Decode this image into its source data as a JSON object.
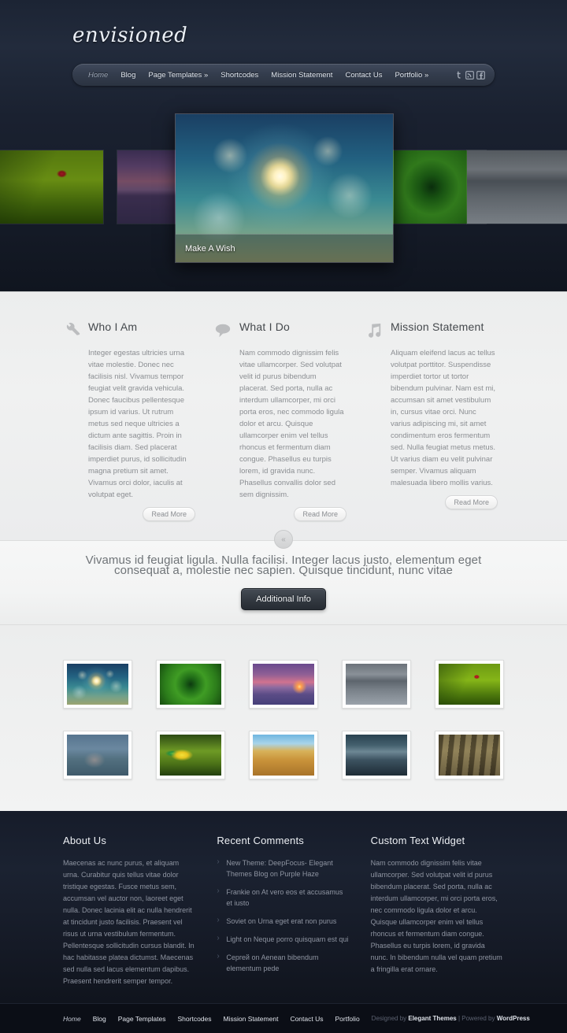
{
  "site": {
    "logo": "envisioned"
  },
  "nav": {
    "items": [
      {
        "label": "Home",
        "active": true
      },
      {
        "label": "Blog",
        "active": false
      },
      {
        "label": "Page Templates »",
        "active": false
      },
      {
        "label": "Shortcodes",
        "active": false
      },
      {
        "label": "Mission Statement",
        "active": false
      },
      {
        "label": "Contact Us",
        "active": false
      },
      {
        "label": "Portfolio »",
        "active": false
      }
    ],
    "social": [
      "twitter-icon",
      "rss-icon",
      "facebook-icon"
    ]
  },
  "slider": {
    "featured_caption": "Make A Wish",
    "thumbs": [
      "grass-ladybug",
      "bridge-sunset",
      "green-leaf",
      "pier-pavilion"
    ]
  },
  "features": {
    "columns": [
      {
        "icon": "wrench-icon",
        "title": "Who I Am",
        "body": "Integer egestas ultricies urna vitae molestie. Donec nec facilisis nisl. Vivamus tempor feugiat velit gravida vehicula. Donec faucibus pellentesque ipsum id varius. Ut rutrum metus sed neque ultricies a dictum ante sagittis. Proin in facilisis diam. Sed placerat imperdiet purus, id sollicitudin magna pretium sit amet. Vivamus orci dolor, iaculis at volutpat eget.",
        "button": "Read More"
      },
      {
        "icon": "speech-bubble-icon",
        "title": "What I Do",
        "body": "Nam commodo dignissim felis vitae ullamcorper. Sed volutpat velit id purus bibendum placerat. Sed porta, nulla ac interdum ullamcorper, mi orci porta eros, nec commodo ligula dolor et arcu. Quisque ullamcorper enim vel tellus rhoncus et fermentum diam congue. Phasellus eu turpis lorem, id gravida nunc. Phasellus convallis dolor sed sem dignissim.",
        "button": "Read More"
      },
      {
        "icon": "music-note-icon",
        "title": "Mission Statement",
        "body": "Aliquam eleifend lacus ac tellus volutpat porttitor. Suspendisse imperdiet tortor ut tortor bibendum pulvinar. Nam est mi, accumsan sit amet vestibulum in, cursus vitae orci. Nunc varius adipiscing mi, sit amet condimentum eros fermentum sed. Nulla feugiat metus metus. Ut varius diam eu velit pulvinar semper. Vivamus aliquam malesuada libero mollis varius.",
        "button": "Read More"
      }
    ]
  },
  "tagline": {
    "badge": "«",
    "text": "Vivamus id feugiat ligula. Nulla facilisi. Integer lacus justo, elementum eget consequat a, molestie nec sapien. Quisque tincidunt, nunc vitae",
    "button": "Additional Info"
  },
  "gallery": {
    "items": [
      {
        "name": "dandelion"
      },
      {
        "name": "green-leaf"
      },
      {
        "name": "bridge-sunset"
      },
      {
        "name": "pier-pavilion"
      },
      {
        "name": "grass-ladybug"
      },
      {
        "name": "snow-monkeys"
      },
      {
        "name": "toucan"
      },
      {
        "name": "wheat-field"
      },
      {
        "name": "seascape"
      },
      {
        "name": "bamboo"
      }
    ]
  },
  "footer": {
    "widgets": [
      {
        "title": "About Us",
        "type": "text",
        "body": "Maecenas ac nunc purus, et aliquam urna. Curabitur quis tellus vitae dolor tristique egestas. Fusce metus sem, accumsan vel auctor non, laoreet eget nulla. Donec lacinia elit ac nulla hendrerit at tincidunt justo facilisis. Praesent vel risus ut urna vestibulum fermentum. Pellentesque sollicitudin cursus blandit. In hac habitasse platea dictumst. Maecenas sed nulla sed lacus elementum dapibus. Praesent hendrerit semper tempor."
      },
      {
        "title": "Recent Comments",
        "type": "list",
        "items": [
          "New Theme: DeepFocus- Elegant Themes Blog on Purple Haze",
          "Frankie on At vero eos et accusamus et iusto",
          "Soviet on Urna eget erat non purus",
          "Light on Neque porro quisquam est qui",
          "Сергей on Aenean bibendum elementum pede"
        ]
      },
      {
        "title": "Custom Text Widget",
        "type": "text",
        "body": "Nam commodo dignissim felis vitae ullamcorper. Sed volutpat velit id purus bibendum placerat. Sed porta, nulla ac interdum ullamcorper, mi orci porta eros, nec commodo ligula dolor et arcu. Quisque ullamcorper enim vel tellus rhoncus et fermentum diam congue. Phasellus eu turpis lorem, id gravida nunc. In bibendum nulla vel quam pretium a fringilla erat ornare."
      }
    ],
    "bottom_nav": [
      {
        "label": "Home",
        "active": true
      },
      {
        "label": "Blog",
        "active": false
      },
      {
        "label": "Page Templates",
        "active": false
      },
      {
        "label": "Shortcodes",
        "active": false
      },
      {
        "label": "Mission Statement",
        "active": false
      },
      {
        "label": "Contact Us",
        "active": false
      },
      {
        "label": "Portfolio",
        "active": false
      }
    ],
    "credit_prefix": "Designed by ",
    "credit_brand1": "Elegant Themes",
    "credit_middle": " | Powered by ",
    "credit_brand2": "WordPress"
  }
}
